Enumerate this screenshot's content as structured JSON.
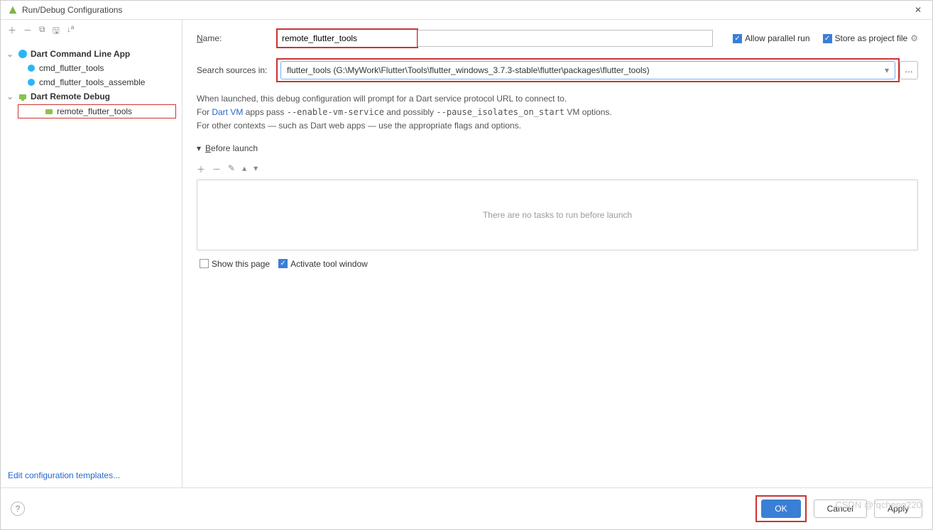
{
  "window": {
    "title": "Run/Debug Configurations"
  },
  "sidebar": {
    "tree": [
      {
        "label": "Dart Command Line App",
        "bold": true
      },
      {
        "label": "cmd_flutter_tools"
      },
      {
        "label": "cmd_flutter_tools_assemble"
      },
      {
        "label": "Dart Remote Debug",
        "bold": true
      },
      {
        "label": "remote_flutter_tools"
      }
    ],
    "edit_templates": "Edit configuration templates..."
  },
  "form": {
    "name_label": "Name:",
    "name_value": "remote_flutter_tools",
    "allow_parallel": "Allow parallel run",
    "store_as_file": "Store as project file",
    "search_label": "Search sources in:",
    "search_value": "flutter_tools (G:\\MyWork\\Flutter\\Tools\\flutter_windows_3.7.3-stable\\flutter\\packages\\flutter_tools)",
    "info_line1": "When launched, this debug configuration will prompt for a Dart service protocol URL to connect to.",
    "info_line2a": "For ",
    "info_link": "Dart VM",
    "info_line2b": " apps pass ",
    "info_flag1": "--enable-vm-service",
    "info_line2c": " and possibly ",
    "info_flag2": "--pause_isolates_on_start",
    "info_line2d": " VM options.",
    "info_line3": "For other contexts — such as Dart web apps — use the appropriate flags and options.",
    "before_launch": "Before launch",
    "no_tasks": "There are no tasks to run before launch",
    "show_this_page": "Show this page",
    "activate_tool": "Activate tool window"
  },
  "footer": {
    "ok": "OK",
    "cancel": "Cancel",
    "apply": "Apply"
  },
  "watermark": "CSDN @fqcheng220"
}
